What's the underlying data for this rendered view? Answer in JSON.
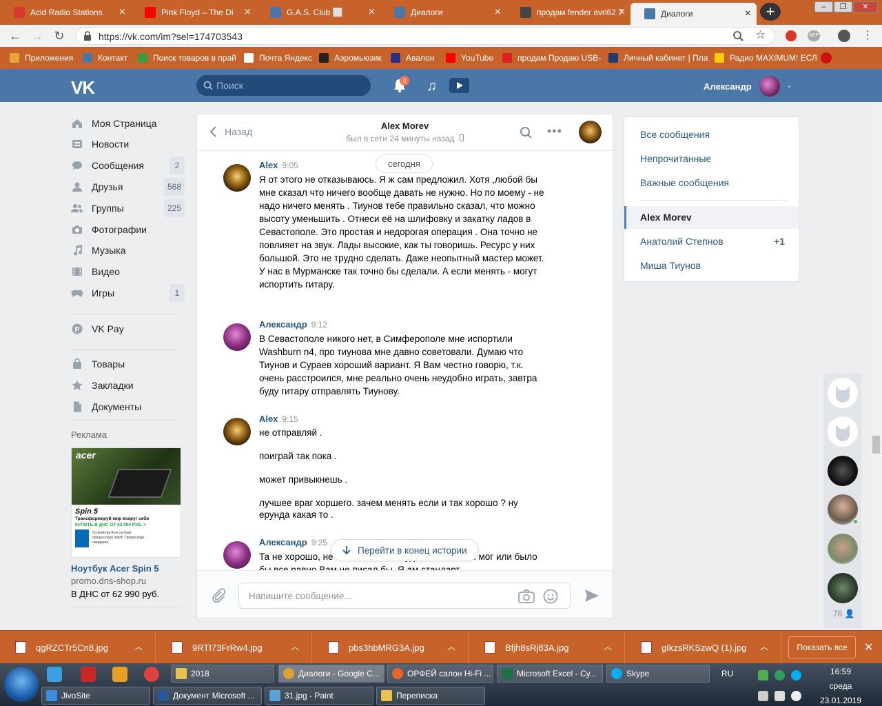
{
  "browser": {
    "tabs": [
      {
        "title": "Acid Radio Stations",
        "color": "#d83a2e"
      },
      {
        "title": "Pink Floyd – The Di",
        "color": "#ff0000"
      },
      {
        "title": "G.A.S. Club ⬜",
        "color": "#4a76a8"
      },
      {
        "title": "Диалоги",
        "color": "#4a76a8"
      },
      {
        "title": "продам fender avri62 7",
        "color": "#444444"
      },
      {
        "title": "Диалоги",
        "color": "#4a76a8"
      }
    ],
    "url": "https://vk.com/im?sel=174703543",
    "bookmarks": [
      {
        "label": "Приложения",
        "color": "#e8a33b"
      },
      {
        "label": "Контакт",
        "color": "#4a76a8"
      },
      {
        "label": "Поиск товаров в прай",
        "color": "#3c9b3c"
      },
      {
        "label": "Почта Яндекс",
        "color": "#ffffff"
      },
      {
        "label": "Аэромьюзик",
        "color": "#222222"
      },
      {
        "label": "Авалон",
        "color": "#2b2f8a"
      },
      {
        "label": "YouTube",
        "color": "#ff0000"
      },
      {
        "label": "продам Продаю USB-",
        "color": "#e02020"
      },
      {
        "label": "Личный кабинет | Пла",
        "color": "#1e3c72"
      },
      {
        "label": "Радио MAXIMUM! ЕСЛ",
        "color": "#ffcc00"
      }
    ]
  },
  "vk": {
    "logo": "VK",
    "search_placeholder": "Поиск",
    "notif_count": "3",
    "user_name": "Александр"
  },
  "left_menu": [
    {
      "label": "Моя Страница",
      "count": "",
      "icon": "home-icon"
    },
    {
      "label": "Новости",
      "count": "",
      "icon": "news-icon"
    },
    {
      "label": "Сообщения",
      "count": "2",
      "icon": "messages-icon"
    },
    {
      "label": "Друзья",
      "count": "568",
      "icon": "friends-icon"
    },
    {
      "label": "Группы",
      "count": "225",
      "icon": "groups-icon"
    },
    {
      "label": "Фотографии",
      "count": "",
      "icon": "camera-icon"
    },
    {
      "label": "Музыка",
      "count": "",
      "icon": "music-icon"
    },
    {
      "label": "Видео",
      "count": "",
      "icon": "video-icon"
    },
    {
      "label": "Игры",
      "count": "1",
      "icon": "games-icon"
    },
    {
      "label": "VK Pay",
      "count": "",
      "icon": "vkpay-icon"
    },
    {
      "label": "Товары",
      "count": "",
      "icon": "bag-icon"
    },
    {
      "label": "Закладки",
      "count": "",
      "icon": "star-icon"
    },
    {
      "label": "Документы",
      "count": "",
      "icon": "document-icon"
    }
  ],
  "ad": {
    "label": "Реклама",
    "brand": "acer",
    "model": "Spin 5",
    "slogan": "Трансформируй мир вокруг себя",
    "cta": "КУПИТЬ В ДНС ОТ 62 990 РУБ. >",
    "small": "Устройства Acer на базе процессоров Intel®. Превосходя ожидания.",
    "title": "Ноутбук Acer Spin 5",
    "domain": "promo.dns-shop.ru",
    "price": "В ДНС от 62 990 руб."
  },
  "chat": {
    "back_label": "Назад",
    "name": "Alex Morev",
    "status": "был в сети 24 минуты назад",
    "day": "сегодня",
    "messages": [
      {
        "author": "Alex",
        "time": "9:05",
        "text": "Я от этого не отказываюсь. Я ж сам предложил. Хотя ,любой бы мне сказал что ничего вообще давать не нужно. Но по моему - не надо ничего менять . Тиунов тебе правильно сказал, что можно высоту уменьшить . Отнеси её на шлифовку и закатку ладов в Севастополе. Это простая и недорогая операция . Она точно не повлияет на звук. Лады высокие, как ты говоришь. Ресурс у них большой. Это не трудно сделать. Даже неопытный мастер может. У нас в Мурманске так точно бы сделали. А если менять - могут испортить гитару."
      },
      {
        "author": "Александр",
        "time": "9:12",
        "text": "В Севастополе никого нет, в Симферополе мне испортили Washburn n4, про тиунова мне давно советовали. Думаю что Тиунов и Сураев хороший вариант. Я Вам честно говорю, т.к. очень расстроился, мне реально очень неудобно играть, завтра буду гитару отправлять Тиунову."
      },
      {
        "author": "Alex",
        "time": "9:15",
        "text": "не отправляй .\n\nпоиграй так пока .\n\nможет привыкнешь .\n\nлучшее враг хоршего. зачем менять если и так хорошо ? ну ерунда какая то ."
      },
      {
        "author": "Александр",
        "time": "9:25",
        "text": "Та не хорошо, не было бы мне неудобно, если бы мог или было бы все равно Вам не писал бы. Я ам стандарт"
      }
    ],
    "to_end": "Перейти в конец истории",
    "input_placeholder": "Напишите сообщение..."
  },
  "right_menu": {
    "items": [
      "Все сообщения",
      "Непрочитанные",
      "Важные сообщения"
    ],
    "dialogs": [
      "Alex Morev",
      "Анатолий Степнов",
      "Миша Тиунов"
    ],
    "stepnov_count": "+1"
  },
  "friends_count": "76",
  "downloads": {
    "files": [
      "qgRZCTr5Cn8.jpg",
      "9RTI73FrRw4.jpg",
      "pbs3hbMRG3A.jpg",
      "Bfjh8sRj83A.jpg",
      "gIkzsRKSzwQ (1).jpg"
    ],
    "show_all": "Показать все"
  },
  "taskbar": {
    "row1": [
      {
        "label": "2018",
        "color": "#e8c24a"
      },
      {
        "label": "Диалоги - Google C...",
        "color": "#e0a030"
      },
      {
        "label": "ОРФЕЙ салон Hi-Fi ...",
        "color": "#e8652a"
      },
      {
        "label": "Microsoft Excel - Cy...",
        "color": "#1e7145"
      },
      {
        "label": "Skype",
        "color": "#00aff0"
      }
    ],
    "row2": [
      {
        "label": "JivoSite",
        "color": "#3c8dde"
      },
      {
        "label": "Документ Microsoft ...",
        "color": "#2b579a"
      },
      {
        "label": "31.jpg - Paint",
        "color": "#5aa1d8"
      },
      {
        "label": "Переписка",
        "color": "#e8c24a"
      }
    ],
    "lang": "RU",
    "time": "16:59",
    "weekday": "среда",
    "date": "23.01.2019"
  }
}
